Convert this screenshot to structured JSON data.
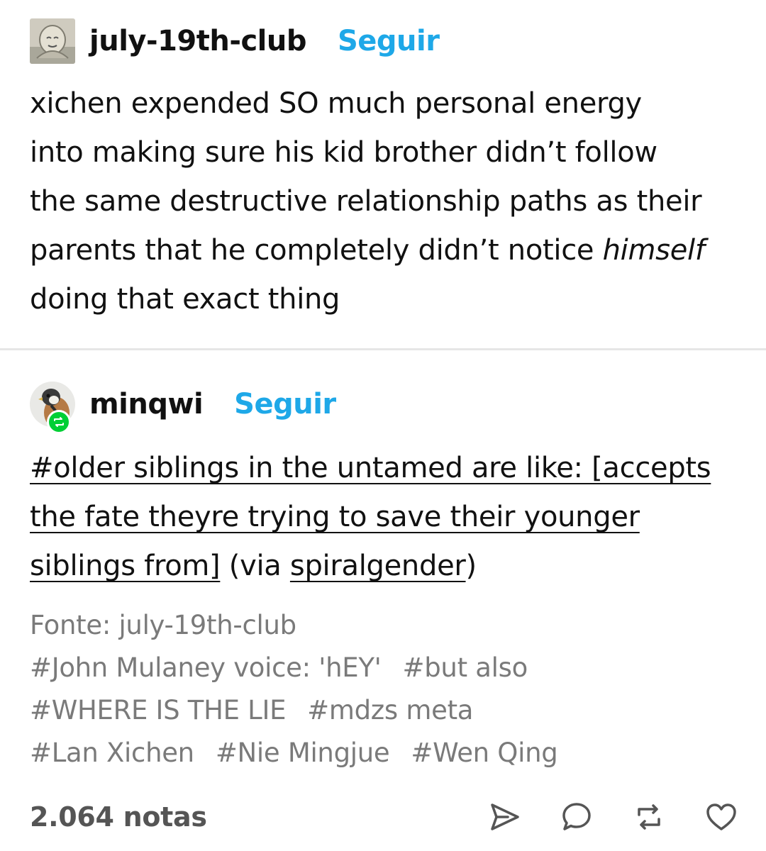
{
  "post1": {
    "username": "july-19th-club",
    "follow_label": "Seguir",
    "text_lines": [
      "xichen expended SO much personal energy",
      "into making sure his kid brother didn’t follow",
      "the same destructive relationship paths as their",
      "parents that he completely didn’t notice "
    ],
    "text_italic": "himself",
    "text_last_line": "doing that exact thing"
  },
  "post2": {
    "username": "minqwi",
    "follow_label": "Seguir",
    "tag_line": "#older siblings in the untamed are like: [accepts the fate theyre trying to save their younger siblings from]",
    "via_open": " (via ",
    "via_name": "spiralgender",
    "via_close": ")"
  },
  "source": "Fonte: july-19th-club",
  "tags": [
    "#John Mulaney voice: 'hEY'",
    "#but also",
    "#WHERE IS THE LIE",
    "#mdzs meta",
    "#Lan Xichen",
    "#Nie Mingjue",
    "#Wen Qing"
  ],
  "footer": {
    "notes": "2.064 notas",
    "icons": [
      "share-icon",
      "reply-icon",
      "reblog-icon",
      "like-icon"
    ]
  },
  "colors": {
    "follow": "#1ea8e8",
    "reblog_badge": "#00cf35",
    "muted_text": "#7a7a7a"
  }
}
